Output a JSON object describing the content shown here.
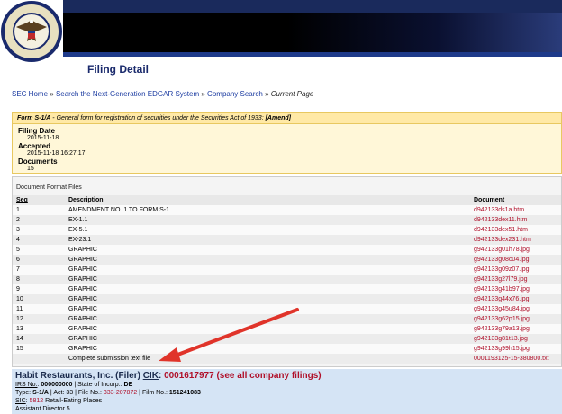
{
  "header": {
    "agency_seal_text": "SECURITIES AND EXCHANGE COMMISSION MCMXXXIV",
    "page_title": "Filing Detail"
  },
  "breadcrumb": {
    "items": [
      "SEC Home",
      "Search the Next-Generation EDGAR System",
      "Company Search"
    ],
    "separator": "»",
    "current": "Current Page"
  },
  "form": {
    "type_label": "Form S-1/A",
    "description": " - General form for registration of securities under the Securities Act of 1933: ",
    "amend": "[Amend]"
  },
  "filing_info": {
    "filing_date_label": "Filing Date",
    "filing_date": "2015-11-18",
    "accepted_label": "Accepted",
    "accepted": "2015-11-18 16:27:17",
    "documents_label": "Documents",
    "documents": "15"
  },
  "documents_section": {
    "title": "Document Format Files",
    "headers": {
      "seq": "Seq",
      "description": "Description",
      "document": "Document"
    },
    "rows": [
      {
        "seq": "1",
        "description": "AMENDMENT NO. 1 TO FORM S-1",
        "document": "d942133ds1a.htm"
      },
      {
        "seq": "2",
        "description": "EX-1.1",
        "document": "d942133dex11.htm"
      },
      {
        "seq": "3",
        "description": "EX-5.1",
        "document": "d942133dex51.htm"
      },
      {
        "seq": "4",
        "description": "EX-23.1",
        "document": "d942133dex231.htm"
      },
      {
        "seq": "5",
        "description": "GRAPHIC",
        "document": "g942133g01h78.jpg"
      },
      {
        "seq": "6",
        "description": "GRAPHIC",
        "document": "g942133g08c04.jpg"
      },
      {
        "seq": "7",
        "description": "GRAPHIC",
        "document": "g942133g09z07.jpg"
      },
      {
        "seq": "8",
        "description": "GRAPHIC",
        "document": "g942133g27l79.jpg"
      },
      {
        "seq": "9",
        "description": "GRAPHIC",
        "document": "g942133g41b97.jpg"
      },
      {
        "seq": "10",
        "description": "GRAPHIC",
        "document": "g942133g44x76.jpg"
      },
      {
        "seq": "11",
        "description": "GRAPHIC",
        "document": "g942133g45u84.jpg"
      },
      {
        "seq": "12",
        "description": "GRAPHIC",
        "document": "g942133g62p15.jpg"
      },
      {
        "seq": "13",
        "description": "GRAPHIC",
        "document": "g942133g79a13.jpg"
      },
      {
        "seq": "14",
        "description": "GRAPHIC",
        "document": "g942133g81t13.jpg"
      },
      {
        "seq": "15",
        "description": "GRAPHIC",
        "document": "g942133g99h15.jpg"
      },
      {
        "seq": "",
        "description": "Complete submission text file",
        "document": "0001193125-15-380800.txt"
      }
    ]
  },
  "filer": {
    "name": "Habit Restaurants, Inc. (Filer)",
    "cik_label": "CIK",
    "cik_value": "0001617977",
    "all_filings": "(see all company filings)",
    "irs_label": "IRS No.",
    "irs_value": "000000000",
    "state_incorp_label": "State of Incorp.:",
    "state_incorp_value": "DE",
    "type_label": "Type:",
    "type_value": "S-1/A",
    "act_label": "Act:",
    "act_value": "33",
    "file_no_label": "File No.:",
    "file_no_value": "333-207872",
    "film_no_label": "Film No.:",
    "film_no_value": "151241083",
    "sic_label": "SIC",
    "sic_value": "5812",
    "sic_desc": "Retail-Eating Places",
    "assistant": "Assistant Director 5"
  },
  "colors": {
    "link_red": "#b0102a",
    "nav_blue": "#1a3aa0",
    "title_navy": "#1a2a6c",
    "form_banner_bg": "#ffe9a6",
    "filer_bg": "#d5e4f5",
    "arrow_red": "#e0342a"
  }
}
